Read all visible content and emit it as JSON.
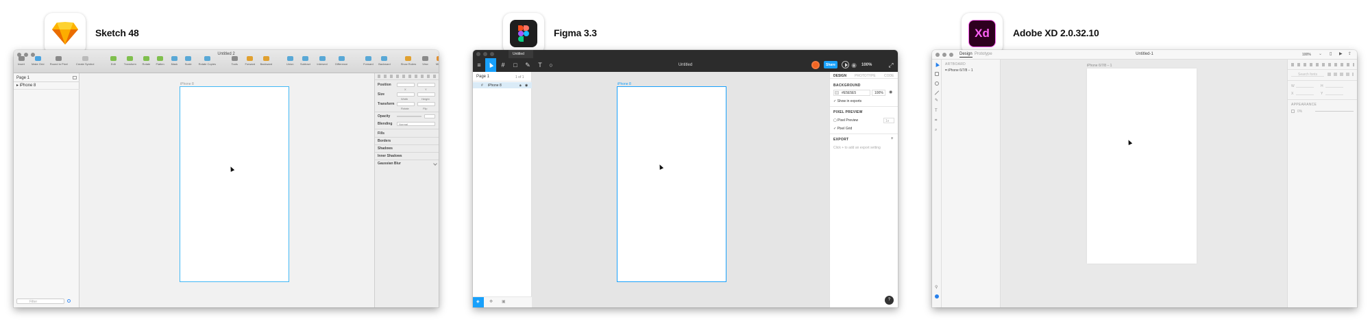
{
  "apps": [
    {
      "title": "Sketch 48",
      "icon": "sketch-diamond-icon"
    },
    {
      "title": "Figma 3.3",
      "icon": "figma-logo-icon"
    },
    {
      "title": "Adobe XD 2.0.32.10",
      "icon": "adobe-xd-logo-icon",
      "icon_text": "Xd"
    }
  ],
  "sketch": {
    "window_title": "Untitled 2",
    "toolbar": [
      "Insert",
      "Make Grid",
      "Round to Pixel",
      "Create Symbol",
      "Edit",
      "Transform",
      "Rotate",
      "Flatten",
      "Mask",
      "Scale",
      "Rotate Copies",
      "Tools",
      "Forward",
      "Backward",
      "Union",
      "Subtract",
      "Intersect",
      "Difference",
      "Forward",
      "Backward",
      "Show Rulers",
      "View",
      "Mirror",
      "Cloud"
    ],
    "page_selector": "Page 1",
    "layer": "iPhone 8",
    "artboard_label": "iPhone 8",
    "filter_placeholder": "Filter",
    "inspector": {
      "position": "Position",
      "size": "Size",
      "width": "Width",
      "height": "Height",
      "transform": "Transform",
      "rotate": "Rotate",
      "flip": "Flip",
      "x": "X",
      "y": "Y",
      "opacity": "Opacity",
      "blending": "Blending",
      "blending_value": "Normal",
      "fills": "Fills",
      "borders": "Borders",
      "shadows": "Shadows",
      "inner_shadows": "Inner Shadows",
      "gaussian_blur": "Gaussian Blur"
    }
  },
  "figma": {
    "window_title": "Untitled",
    "file_name": "Untitled",
    "share": "Share",
    "zoom": "100%",
    "page": "Page 1",
    "page_count": "1 of 1",
    "layer": "iPhone 8",
    "artboard_label": "iPhone 8",
    "tabs": [
      "DESIGN",
      "PROTOTYPE",
      "CODE"
    ],
    "background_label": "BACKGROUND",
    "background_hex": "#E5E5E5",
    "background_opacity": "100%",
    "show_in_exports": "Show in exports",
    "pixel_preview_label": "PIXEL PREVIEW",
    "pixel_preview": "Pixel Preview",
    "pixel_preview_value": "1x",
    "pixel_grid": "Pixel Grid",
    "export_label": "EXPORT",
    "export_hint": "Click + to add an export setting",
    "help": "?"
  },
  "xd": {
    "window_title": "Untitled-1",
    "tabs": [
      "Design",
      "Prototype"
    ],
    "zoom": "100%",
    "layers_label": "ARTBOARD",
    "layer": "iPhone 6/7/8 – 1",
    "artboard_label": "iPhone 6/7/8 – 1",
    "search_placeholder": "Search fonts",
    "appearance_label": "APPEARANCE",
    "w": "W",
    "h": "H",
    "x": "X",
    "y": "Y",
    "opacity_value": "0%"
  },
  "colors": {
    "selection_blue": "#1fb3f7",
    "figma_blue": "#18a0fb",
    "figma_toolbar": "#2c2c2c",
    "sketch_orange": "#fdb300",
    "xd_dark": "#2e001f",
    "xd_pink": "#ff61f6"
  }
}
